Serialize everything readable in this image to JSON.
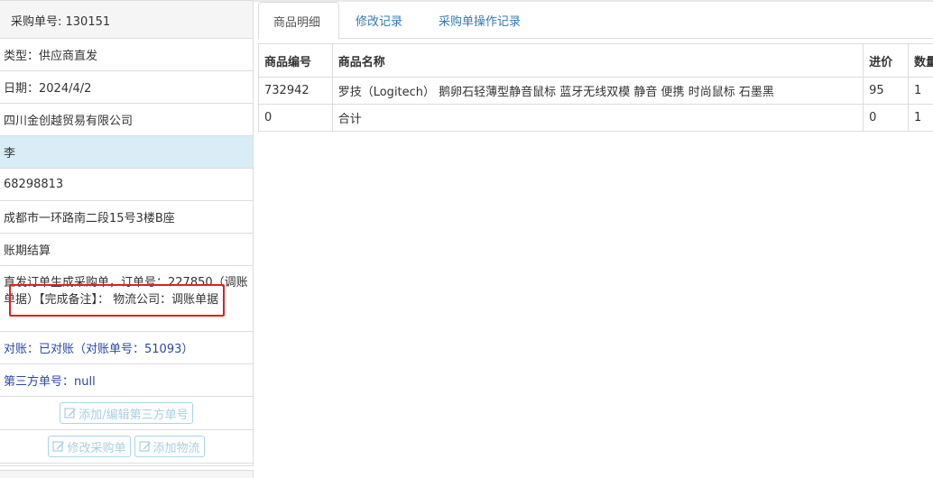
{
  "left_panel": {
    "order_no_label": "采购单号: 130151",
    "type_text": "类型：供应商直发",
    "date_text": "日期：2024/4/2",
    "supplier": "四川金创越贸易有限公司",
    "contact": "李",
    "phone": "68298813",
    "address": "成都市一环路南二段15号3楼B座",
    "settlement": "账期结算",
    "remark": "直发订单生成采购单，订单号：227850（调账单据）【完成备注】： 物流公司：调账单据",
    "reconcile_text": "对账：已对账（对账单号：51093）",
    "third_party_text": "第三方单号：null",
    "btn_third_party": "添加/编辑第三方单号",
    "btn_edit_order": "修改采购单",
    "btn_add_logistics": "添加物流"
  },
  "tabs": [
    {
      "label": "商品明细",
      "active": true
    },
    {
      "label": "修改记录",
      "active": false
    },
    {
      "label": "采购单操作记录",
      "active": false
    }
  ],
  "table": {
    "headers": [
      "商品编号",
      "商品名称",
      "进价",
      "数量"
    ],
    "rows": [
      [
        "732942",
        "罗技（Logitech） 鹅卵石轻薄型静音鼠标 蓝牙无线双模 静音 便携 时尚鼠标 石墨黑",
        "95",
        "1"
      ],
      [
        "0",
        "合计",
        "0",
        "1"
      ]
    ]
  },
  "colors": {
    "selected_row": "#d9edf7",
    "link_blue": "#2b47a8",
    "highlight_box": "#e02020"
  }
}
